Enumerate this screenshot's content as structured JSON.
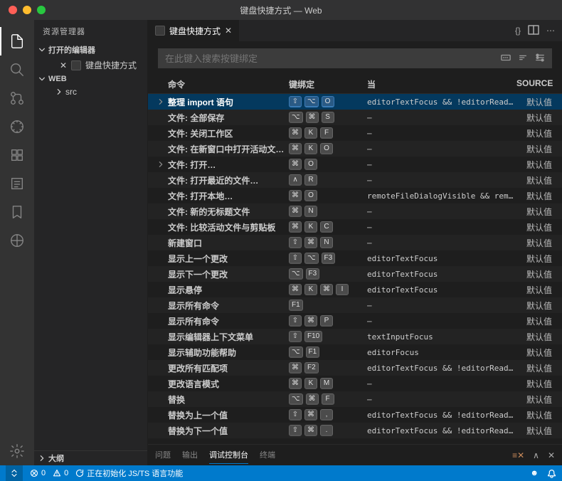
{
  "window_title": "键盘快捷方式 — Web",
  "sidebar": {
    "title": "资源管理器",
    "open_editors_label": "打开的编辑器",
    "open_file": "键盘快捷方式",
    "workspace_label": "WEB",
    "src_folder": "src",
    "outline_label": "大纲"
  },
  "tab": {
    "label": "键盘快捷方式"
  },
  "search": {
    "placeholder": "在此键入搜索按键绑定"
  },
  "table": {
    "headers": {
      "command": "命令",
      "keybinding": "键绑定",
      "when": "当",
      "source": "SOURCE"
    },
    "rows": [
      {
        "chev": true,
        "cmd": "整理 import 语句",
        "keys": [
          "⇧",
          "⌥",
          "O"
        ],
        "when": "editorTextFocus && !editorReadon…",
        "src": "默认值",
        "selected": true
      },
      {
        "cmd": "文件: 全部保存",
        "keys": [
          "⌥",
          "⌘",
          "S"
        ],
        "when": "—",
        "src": "默认值"
      },
      {
        "cmd": "文件: 关闭工作区",
        "keys": [
          "⌘",
          "K",
          "F"
        ],
        "when": "—",
        "src": "默认值"
      },
      {
        "cmd": "文件: 在新窗口中打开活动文…",
        "keys": [
          "⌘",
          "K",
          "O"
        ],
        "when": "—",
        "src": "默认值"
      },
      {
        "chev": true,
        "cmd": "文件: 打开…",
        "keys": [
          "⌘",
          "O"
        ],
        "when": "—",
        "src": "默认值"
      },
      {
        "cmd": "文件: 打开最近的文件…",
        "keys": [
          "∧",
          "R"
        ],
        "when": "—",
        "src": "默认值"
      },
      {
        "cmd": "文件: 打开本地…",
        "keys": [
          "⌘",
          "O"
        ],
        "when": "remoteFileDialogVisible && remot…",
        "src": "默认值"
      },
      {
        "cmd": "文件: 新的无标题文件",
        "keys": [
          "⌘",
          "N"
        ],
        "when": "—",
        "src": "默认值"
      },
      {
        "cmd": "文件: 比较活动文件与剪贴板",
        "keys": [
          "⌘",
          "K",
          "C"
        ],
        "when": "—",
        "src": "默认值"
      },
      {
        "cmd": "新建窗口",
        "keys": [
          "⇧",
          "⌘",
          "N"
        ],
        "when": "—",
        "src": "默认值"
      },
      {
        "cmd": "显示上一个更改",
        "keys": [
          "⇧",
          "⌥",
          "F3"
        ],
        "when": "editorTextFocus",
        "src": "默认值"
      },
      {
        "cmd": "显示下一个更改",
        "keys": [
          "⌥",
          "F3"
        ],
        "when": "editorTextFocus",
        "src": "默认值"
      },
      {
        "cmd": "显示悬停",
        "keys": [
          "⌘",
          "K",
          "⌘",
          "I"
        ],
        "when": "editorTextFocus",
        "src": "默认值"
      },
      {
        "cmd": "显示所有命令",
        "keys": [
          "F1"
        ],
        "when": "—",
        "src": "默认值"
      },
      {
        "cmd": "显示所有命令",
        "keys": [
          "⇧",
          "⌘",
          "P"
        ],
        "when": "—",
        "src": "默认值"
      },
      {
        "cmd": "显示编辑器上下文菜单",
        "keys": [
          "⇧",
          "F10"
        ],
        "when": "textInputFocus",
        "src": "默认值"
      },
      {
        "cmd": "显示辅助功能帮助",
        "keys": [
          "⌥",
          "F1"
        ],
        "when": "editorFocus",
        "src": "默认值"
      },
      {
        "cmd": "更改所有匹配项",
        "keys": [
          "⌘",
          "F2"
        ],
        "when": "editorTextFocus && !editorReadon…",
        "src": "默认值"
      },
      {
        "cmd": "更改语言模式",
        "keys": [
          "⌘",
          "K",
          "M"
        ],
        "when": "—",
        "src": "默认值"
      },
      {
        "cmd": "替换",
        "keys": [
          "⌥",
          "⌘",
          "F"
        ],
        "when": "—",
        "src": "默认值"
      },
      {
        "cmd": "替换为上一个值",
        "keys": [
          "⇧",
          "⌘",
          ","
        ],
        "when": "editorTextFocus && !editorReadon…",
        "src": "默认值"
      },
      {
        "cmd": "替换为下一个值",
        "keys": [
          "⇧",
          "⌘",
          "."
        ],
        "when": "editorTextFocus && !editorReadon",
        "src": "默认值"
      }
    ]
  },
  "panel": {
    "tabs": [
      "问题",
      "输出",
      "调试控制台",
      "终端"
    ],
    "active": 2
  },
  "status": {
    "errors": "0",
    "warnings": "0",
    "init_msg": "正在初始化 JS/TS 语言功能"
  }
}
